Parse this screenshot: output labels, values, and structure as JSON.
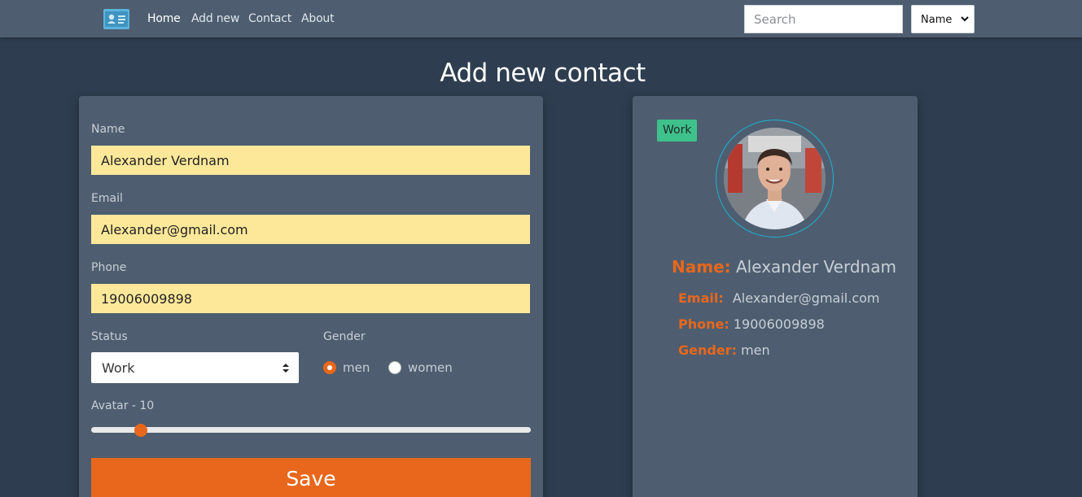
{
  "nav": {
    "links": [
      "Home",
      "Add new",
      "Contact",
      "About"
    ],
    "search_placeholder": "Search",
    "sort_value": "Name"
  },
  "page": {
    "title": "Add new contact"
  },
  "form": {
    "name_label": "Name",
    "name_value": "Alexander Verdnam",
    "email_label": "Email",
    "email_value": "Alexander@gmail.com",
    "phone_label": "Phone",
    "phone_value": "19006009898",
    "status_label": "Status",
    "status_value": "Work",
    "gender_label": "Gender",
    "gender_options": [
      "men",
      "women"
    ],
    "gender_selected": "men",
    "avatar_label": "Avatar - 10",
    "avatar_value": 10,
    "avatar_max": 99,
    "save_label": "Save"
  },
  "preview": {
    "status_badge": "Work",
    "name_key": "Name:",
    "name_value": "Alexander Verdnam",
    "email_key": "Email:",
    "email_value": "Alexander@gmail.com",
    "phone_key": "Phone:",
    "phone_value": "19006009898",
    "gender_key": "Gender:",
    "gender_value": "men"
  },
  "colors": {
    "accent": "#e8671c",
    "navbar": "#4e5e70",
    "background": "#2e3e50",
    "input_fill": "#fde89a",
    "badge_green": "#3fc18b",
    "avatar_ring": "#1bb3d3"
  },
  "icons": {
    "brand": "address-card-icon",
    "sort_chevron": "chevron-down-icon",
    "status_arrows": "up-down-arrows-icon"
  }
}
